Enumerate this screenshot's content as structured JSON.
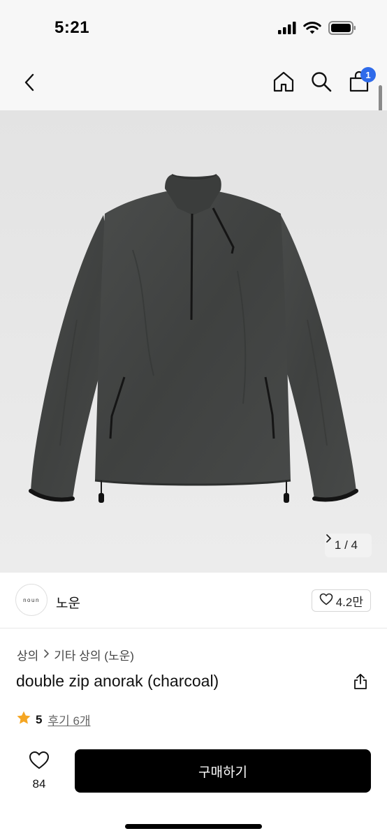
{
  "status_bar": {
    "time": "5:21",
    "icons": [
      "signal-icon",
      "wifi-icon",
      "battery-icon"
    ]
  },
  "nav": {
    "back_icon": "chevron-left-icon",
    "home_icon": "home-icon",
    "search_icon": "search-icon",
    "cart_icon": "shopping-bag-icon",
    "cart_badge": "1",
    "accent_color": "#2f6bea"
  },
  "gallery": {
    "counter": "1 / 4",
    "next_icon": "chevron-right-icon"
  },
  "store": {
    "logo_text": "noun",
    "name": "노운",
    "likes": "4.2만"
  },
  "breadcrumb": {
    "category": "상의",
    "subcategory": "기타 상의 (노운)"
  },
  "product": {
    "title": "double zip anorak (charcoal)",
    "rating": "5",
    "reviews": "후기 6개",
    "star_color": "#f5a623"
  },
  "bottom_bar": {
    "like_count": "84",
    "buy_label": "구매하기"
  }
}
